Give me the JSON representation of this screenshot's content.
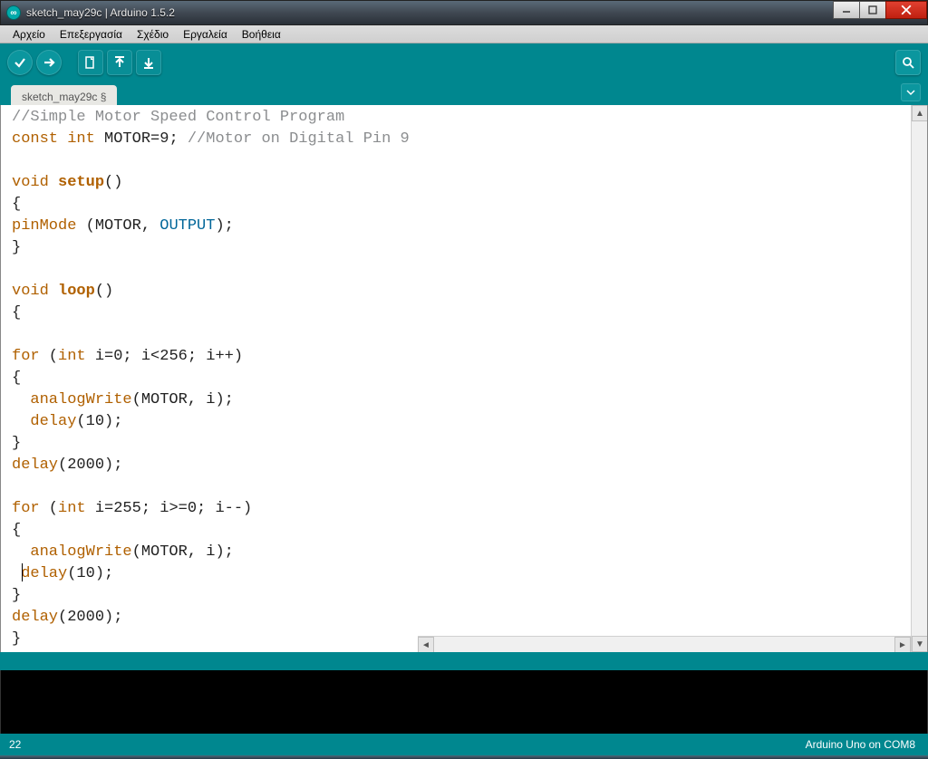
{
  "window": {
    "title": "sketch_may29c | Arduino 1.5.2"
  },
  "menu": {
    "items": [
      "Αρχείο",
      "Επεξεργασία",
      "Σχέδιο",
      "Εργαλεία",
      "Βοήθεια"
    ]
  },
  "tabs": {
    "active": "sketch_may29c §"
  },
  "code_lines": [
    {
      "t": "comment",
      "text": "//Simple Motor Speed Control Program"
    },
    {
      "t": "const_decl",
      "kw1": "const",
      "kw2": "int",
      "rest": " MOTOR=9; ",
      "comment": "//Motor on Digital Pin 9"
    },
    {
      "t": "blank",
      "text": ""
    },
    {
      "t": "void_fn",
      "kw": "void",
      "fn": "setup",
      "rest": "()"
    },
    {
      "t": "plain",
      "text": "{"
    },
    {
      "t": "pinmode",
      "fn": "pinMode",
      "mid": " (MOTOR, ",
      "c": "OUTPUT",
      "rest": ");"
    },
    {
      "t": "plain",
      "text": "}"
    },
    {
      "t": "blank",
      "text": ""
    },
    {
      "t": "void_fn",
      "kw": "void",
      "fn": "loop",
      "rest": "()"
    },
    {
      "t": "plain",
      "text": "{"
    },
    {
      "t": "blank",
      "text": ""
    },
    {
      "t": "for",
      "kw1": "for",
      "mid1": " (",
      "kw2": "int",
      "rest": " i=0; i<256; i++)"
    },
    {
      "t": "plain",
      "text": "{"
    },
    {
      "t": "call",
      "indent": "  ",
      "fn": "analogWrite",
      "rest": "(MOTOR, i);"
    },
    {
      "t": "call",
      "indent": "  ",
      "fn": "delay",
      "rest": "(10);"
    },
    {
      "t": "plain",
      "text": "}"
    },
    {
      "t": "call",
      "indent": "",
      "fn": "delay",
      "rest": "(2000);"
    },
    {
      "t": "blank",
      "text": ""
    },
    {
      "t": "for",
      "kw1": "for",
      "mid1": " (",
      "kw2": "int",
      "rest": " i=255; i>=0; i--)"
    },
    {
      "t": "plain",
      "text": "{"
    },
    {
      "t": "call",
      "indent": "  ",
      "fn": "analogWrite",
      "rest": "(MOTOR, i);"
    },
    {
      "t": "call",
      "indent": " ",
      "fn": "delay",
      "rest": "(10);"
    },
    {
      "t": "plain",
      "text": "}"
    },
    {
      "t": "call",
      "indent": "",
      "fn": "delay",
      "rest": "(2000);"
    },
    {
      "t": "plain",
      "text": "}"
    }
  ],
  "status": {
    "line": "22",
    "board": "Arduino Uno on COM8"
  }
}
